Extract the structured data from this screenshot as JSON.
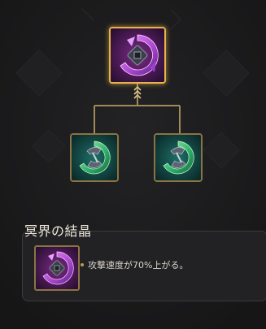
{
  "colors": {
    "background": "#1b1b1c",
    "frame_gold": "#8a7443",
    "highlight_gold": "#e7b24a",
    "result_gem": "#b04ad6",
    "component_gem": "#2fb56b"
  },
  "recipe": {
    "result": {
      "name": "冥界の結晶",
      "icon": "crystal-purple-icon",
      "selected": true
    },
    "components": [
      {
        "icon": "crystal-green-icon"
      },
      {
        "icon": "crystal-green-icon"
      }
    ]
  },
  "detail": {
    "title": "冥界の結晶",
    "icon": "crystal-purple-icon",
    "stats": [
      "攻撃速度が70%上がる。"
    ]
  }
}
